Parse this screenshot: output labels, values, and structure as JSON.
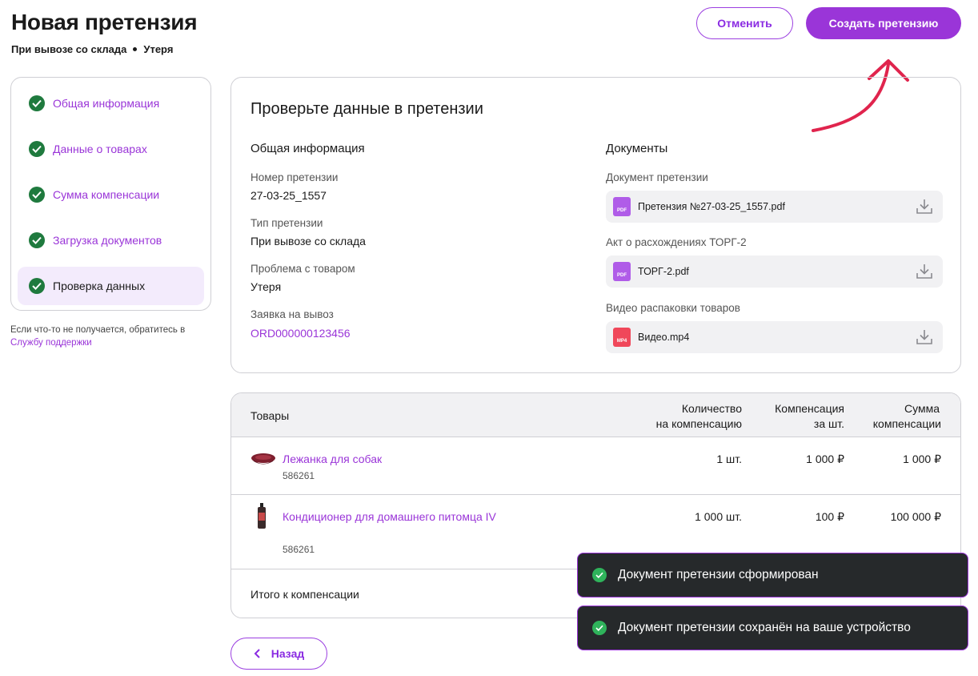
{
  "header": {
    "title": "Новая претензия",
    "subtitle_type": "При вывозе со склада",
    "subtitle_problem": "Утеря",
    "cancel_label": "Отменить",
    "create_label": "Создать претензию"
  },
  "steps": [
    {
      "label": "Общая информация",
      "done": true
    },
    {
      "label": "Данные о товарах",
      "done": true
    },
    {
      "label": "Сумма компенсации",
      "done": true
    },
    {
      "label": "Загрузка документов",
      "done": true
    },
    {
      "label": "Проверка данных",
      "done": true,
      "active": true
    }
  ],
  "help": {
    "text": "Если что-то не получается, обратитесь в",
    "link": "Службу поддержки"
  },
  "review": {
    "title": "Проверьте данные в претензии",
    "general_heading": "Общая информация",
    "fields": [
      {
        "label": "Номер претензии",
        "value": "27-03-25_1557"
      },
      {
        "label": "Тип претензии",
        "value": "При вывозе со склада"
      },
      {
        "label": "Проблема с товаром",
        "value": "Утеря"
      },
      {
        "label": "Заявка на вывоз",
        "value": "ORD000000123456"
      }
    ],
    "docs_heading": "Документы",
    "documents": [
      {
        "label": "Документ претензии",
        "file": "Претензия №27-03-25_1557.pdf",
        "icon_text": "PDF",
        "icon": "pdf-file-icon"
      },
      {
        "label": "Акт о расхождениях ТОРГ-2",
        "file": "ТОРГ-2.pdf",
        "icon_text": "PDF",
        "icon": "pdf-file-icon"
      },
      {
        "label": "Видео распаковки товаров",
        "file": "Видео.mp4",
        "icon_text": "MP4",
        "icon": "video-file-icon"
      }
    ]
  },
  "goods": {
    "columns": [
      "Товары",
      "Количество",
      "на компенсацию",
      "Компенсация",
      "за шт.",
      "Сумма",
      "компенсации"
    ],
    "rows": [
      {
        "name": "Лежанка для собак",
        "sku": "586261",
        "qty": "1 шт.",
        "price": "1 000 ₽",
        "total": "1 000 ₽"
      },
      {
        "name": "Кондиционер для домашнего питомца IV",
        "sku": "586261",
        "qty": "1 000 шт.",
        "price": "100 ₽",
        "total": "100 000 ₽"
      }
    ],
    "total_label": "Итого к компенсации"
  },
  "back_label": "Назад",
  "toasts": [
    "Документ претензии сформирован",
    "Документ претензии сохранён на ваше устройство"
  ],
  "colors": {
    "accent": "#9a35d8",
    "success": "#1f7a3e",
    "toast_bg": "#26292b",
    "arrow": "#e0244d"
  }
}
